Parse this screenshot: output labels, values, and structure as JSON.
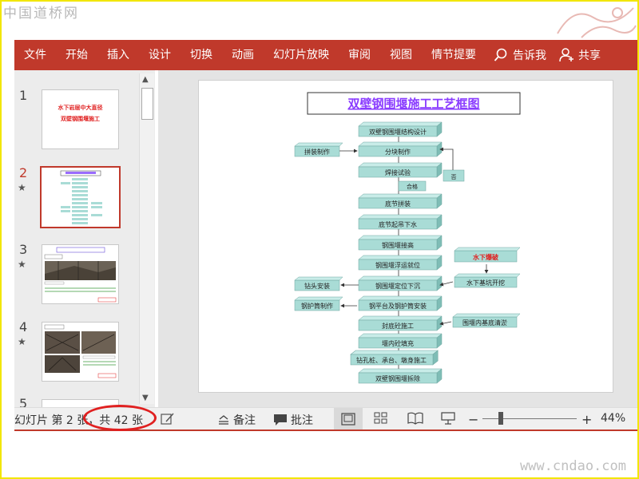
{
  "watermark": {
    "top": "中国道桥网",
    "bottom": "www.cndao.com"
  },
  "ribbon": {
    "tabs": [
      "文件",
      "开始",
      "插入",
      "设计",
      "切换",
      "动画",
      "幻灯片放映",
      "审阅",
      "视图",
      "情节提要"
    ],
    "search_label": "告诉我",
    "share_label": "共享"
  },
  "thumbnails": [
    {
      "number": "1",
      "star": "",
      "lines": [
        "水下岩层中大直径",
        "双壁钢围堰施工"
      ]
    },
    {
      "number": "2",
      "star": "★"
    },
    {
      "number": "3",
      "star": "★"
    },
    {
      "number": "4",
      "star": "★"
    },
    {
      "number": "5",
      "star": ""
    }
  ],
  "slide": {
    "title": "双壁钢围堰施工工艺框图",
    "flow": [
      "双壁钢围堰结构设计",
      "分块制作",
      "焊接试验",
      "底节拼装",
      "底节起吊下水",
      "钢围堰接高",
      "钢围堰浮运就位",
      "钢围堰定位下沉",
      "钢平台及钢护筒安装",
      "封底砼施工",
      "堰内砼填充",
      "钻孔桩、承台、墩身施工",
      "双壁钢围堰拆除"
    ],
    "left_boxes": [
      "拼装制作",
      "钻头安装",
      "钢护筒制作"
    ],
    "right_boxes": [
      "水下爆破",
      "水下基坑开挖",
      "围堰内基底清淤"
    ],
    "pass_label": "合格",
    "fail_label": "否"
  },
  "status": {
    "slide_info": "幻灯片 第 2 张，共 42 张",
    "notes_label": "备注",
    "comments_label": "批注",
    "zoom": "44%"
  },
  "colors": {
    "ribbon": "#c0392b",
    "box": "#a9dcd6",
    "title": "#8a3cff",
    "annotation": "#e02020"
  }
}
